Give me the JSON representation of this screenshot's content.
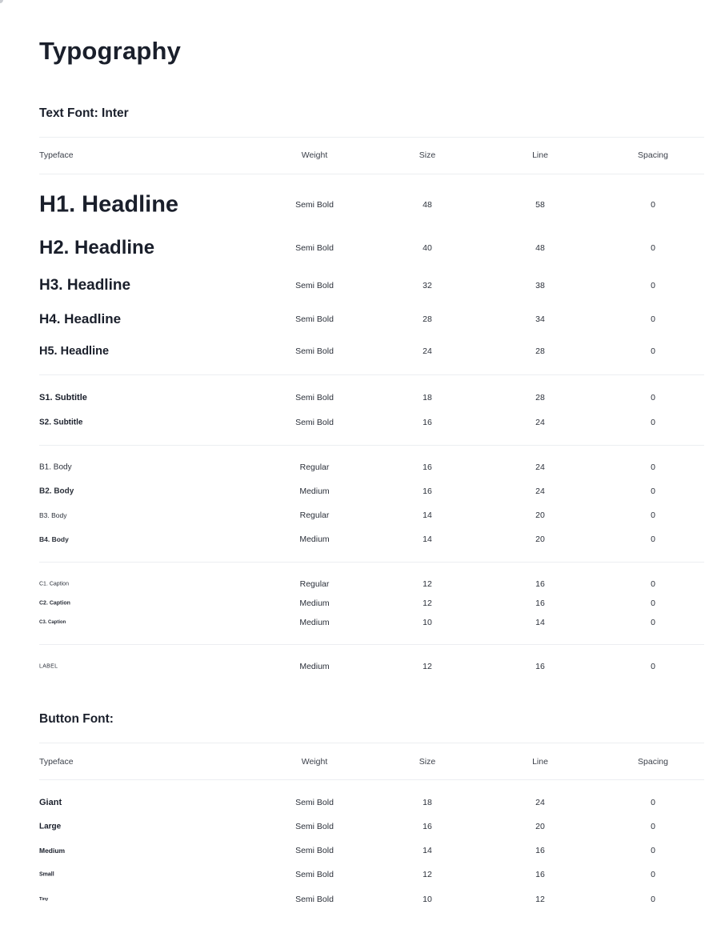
{
  "page": {
    "title": "Typography"
  },
  "text_font": {
    "title": "Text Font: Inter",
    "columns": [
      "Typeface",
      "Weight",
      "Size",
      "Line",
      "Spacing"
    ],
    "rows": [
      {
        "name": "H1. Headline",
        "weight": "Semi Bold",
        "size": "48",
        "line": "58",
        "spacing": "0"
      },
      {
        "name": "H2. Headline",
        "weight": "Semi Bold",
        "size": "40",
        "line": "48",
        "spacing": "0"
      },
      {
        "name": "H3. Headline",
        "weight": "Semi Bold",
        "size": "32",
        "line": "38",
        "spacing": "0"
      },
      {
        "name": "H4. Headline",
        "weight": "Semi Bold",
        "size": "28",
        "line": "34",
        "spacing": "0"
      },
      {
        "name": "H5. Headline",
        "weight": "Semi Bold",
        "size": "24",
        "line": "28",
        "spacing": "0"
      },
      {
        "name": "S1. Subtitle",
        "weight": "Semi Bold",
        "size": "18",
        "line": "28",
        "spacing": "0"
      },
      {
        "name": "S2. Subtitle",
        "weight": "Semi Bold",
        "size": "16",
        "line": "24",
        "spacing": "0"
      },
      {
        "name": "B1. Body",
        "weight": "Regular",
        "size": "16",
        "line": "24",
        "spacing": "0"
      },
      {
        "name": "B2. Body",
        "weight": "Medium",
        "size": "16",
        "line": "24",
        "spacing": "0"
      },
      {
        "name": "B3. Body",
        "weight": "Regular",
        "size": "14",
        "line": "20",
        "spacing": "0"
      },
      {
        "name": "B4. Body",
        "weight": "Medium",
        "size": "14",
        "line": "20",
        "spacing": "0"
      },
      {
        "name": "C1. Caption",
        "weight": "Regular",
        "size": "12",
        "line": "16",
        "spacing": "0"
      },
      {
        "name": "C2. Caption",
        "weight": "Medium",
        "size": "12",
        "line": "16",
        "spacing": "0"
      },
      {
        "name": "C3. Caption",
        "weight": "Medium",
        "size": "10",
        "line": "14",
        "spacing": "0"
      },
      {
        "name": "LABEL",
        "weight": "Medium",
        "size": "12",
        "line": "16",
        "spacing": "0"
      }
    ]
  },
  "button_font": {
    "title": "Button Font:",
    "columns": [
      "Typeface",
      "Weight",
      "Size",
      "Line",
      "Spacing"
    ],
    "rows": [
      {
        "name": "Giant",
        "weight": "Semi Bold",
        "size": "18",
        "line": "24",
        "spacing": "0"
      },
      {
        "name": "Large",
        "weight": "Semi Bold",
        "size": "16",
        "line": "20",
        "spacing": "0"
      },
      {
        "name": "Medium",
        "weight": "Semi Bold",
        "size": "14",
        "line": "16",
        "spacing": "0"
      },
      {
        "name": "Small",
        "weight": "Semi Bold",
        "size": "12",
        "line": "16",
        "spacing": "0"
      },
      {
        "name": "Tiny",
        "weight": "Semi Bold",
        "size": "10",
        "line": "12",
        "spacing": "0"
      }
    ]
  }
}
